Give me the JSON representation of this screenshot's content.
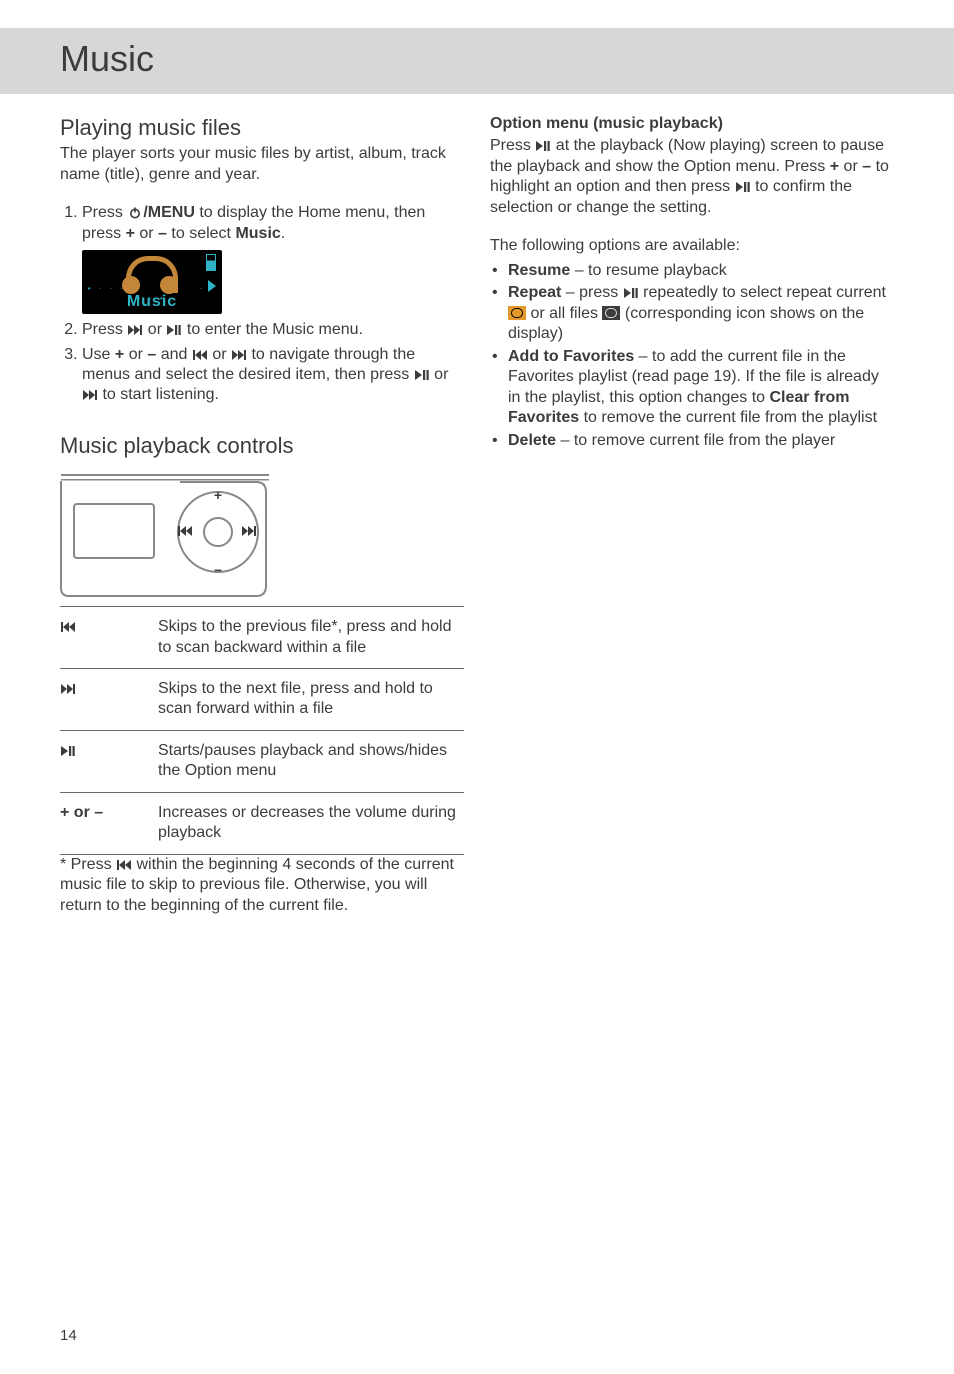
{
  "page_number": "14",
  "title": "Music",
  "left": {
    "h_playing": "Playing music files",
    "intro": "The player sorts your music files by artist, album, track name (title), genre and year.",
    "step1_a": "Press ",
    "step1_b": "/MENU",
    "step1_c": " to display the Home menu, then press ",
    "plus": "+",
    "or": " or ",
    "minus": "–",
    "step1_d": " to select ",
    "music_bold": "Music",
    "period": ".",
    "device_label": "Music",
    "step2_a": "Press ",
    "step2_b": " or ",
    "step2_c": " to enter the Music menu.",
    "step3_a": "Use ",
    "step3_b": " and ",
    "step3_c": " to navigate through the menus and select the desired item, then press ",
    "step3_d": " or ",
    "step3_e": " to start listening.",
    "h_controls": "Music playback controls",
    "row1_desc": "Skips to the previous file*, press and hold to scan backward within a file",
    "row2_desc": "Skips to the next file, press and hold to scan forward within a file",
    "row3_desc": "Starts/pauses playback and shows/hides the Option menu",
    "row4_key": "+ or –",
    "row4_desc": "Increases or decreases the volume during playback",
    "footnote_a": "* Press ",
    "footnote_b": " within the beginning 4 seconds of the current music file to skip to previous file. Otherwise, you will return to the beginning of the current file."
  },
  "right": {
    "heading": "Option menu (music playback)",
    "p1_a": "Press ",
    "p1_b": " at the playback (Now playing) screen to pause the playback and show the Option menu. Press ",
    "p1_c": " to highlight an option and then press ",
    "p1_d": " to confirm the selection or change the setting.",
    "p2": "The following options are available:",
    "resume_b": "Resume",
    "resume_t": " – to resume playback",
    "repeat_b": "Repeat",
    "repeat_t1": " – press ",
    "repeat_t2": " repeatedly to select repeat current ",
    "repeat_t3": " or all files ",
    "repeat_t4": " (corresponding icon shows on the display)",
    "fav_b": "Add to Favorites",
    "fav_t1": " – to add the current file in the Favorites playlist (read page 19). If the file is already in the playlist, this option changes to ",
    "fav_clear": "Clear from Favorites",
    "fav_t2": " to remove the current file from the playlist",
    "del_b": "Delete",
    "del_t": " – to remove current file from the player"
  }
}
